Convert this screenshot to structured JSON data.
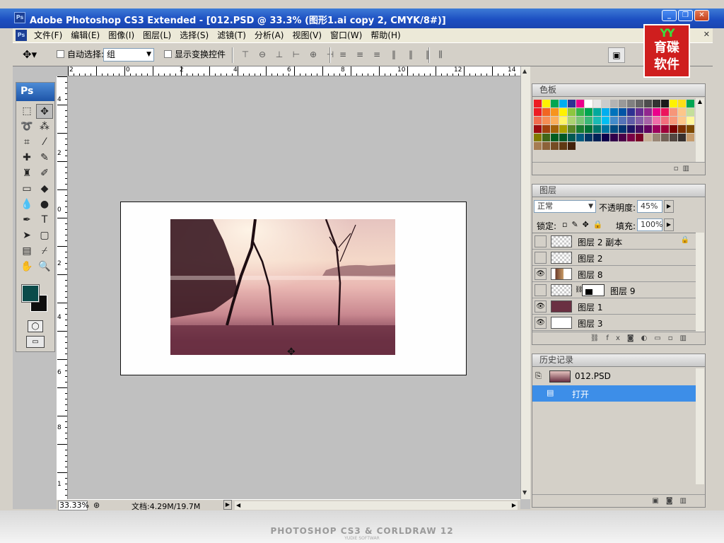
{
  "window": {
    "title": "Adobe Photoshop CS3 Extended - [012.PSD @ 33.3% (图形1.ai copy 2, CMYK/8#)]",
    "app_badge": "Ps",
    "controls": [
      "minimize",
      "restore",
      "close"
    ]
  },
  "menubar": {
    "items": [
      "文件(F)",
      "编辑(E)",
      "图像(I)",
      "图层(L)",
      "选择(S)",
      "滤镜(T)",
      "分析(A)",
      "视图(V)",
      "窗口(W)",
      "帮助(H)"
    ]
  },
  "options": {
    "auto_select_label": "自动选择:",
    "auto_select_checked": false,
    "group_value": "组",
    "show_transform_label": "显示变换控件",
    "show_transform_checked": false
  },
  "logo": {
    "mark": "YY",
    "line1": "育碟",
    "line2": "软件"
  },
  "toolbox": {
    "header": "Ps",
    "foreground_color": "#0b4b4a",
    "background_color": "#0e0e0e"
  },
  "rulers": {
    "top_labels": [
      "2",
      "0",
      "2",
      "4",
      "6",
      "8",
      "10",
      "12",
      "14"
    ],
    "left_labels": [
      "4",
      "2",
      "0",
      "2",
      "4",
      "6",
      "8",
      "1"
    ]
  },
  "status": {
    "zoom": "33.33%",
    "doc_size": "文档:4.29M/19.7M"
  },
  "panels": {
    "swatches": {
      "title": "色板",
      "colors": [
        "#ed1c24",
        "#fff200",
        "#00a651",
        "#00aeef",
        "#2e3192",
        "#ec008c",
        "#ffffff",
        "#e6e6e6",
        "#cccccc",
        "#b3b3b3",
        "#999999",
        "#808080",
        "#666666",
        "#4d4d4d",
        "#333333",
        "#1a1a1a",
        "#fff200",
        "#ffde17",
        "#00a651",
        "#ed1c24",
        "#f26522",
        "#f7941d",
        "#fff200",
        "#8dc63f",
        "#39b54a",
        "#00a651",
        "#00a99d",
        "#00aeef",
        "#0072bc",
        "#0054a6",
        "#2e3192",
        "#662d91",
        "#92278f",
        "#ec008c",
        "#ed145b",
        "#f69679",
        "#fdc689",
        "#c4df9b",
        "#f26c4f",
        "#f68e55",
        "#fbaf5c",
        "#fff467",
        "#acd372",
        "#7cc576",
        "#3bb878",
        "#1abbb4",
        "#00bff3",
        "#438ccb",
        "#5574b9",
        "#605ca8",
        "#855fa8",
        "#a763a8",
        "#f06eaa",
        "#f26d7d",
        "#f7977a",
        "#fdc68a",
        "#fff79a",
        "#9e0b0f",
        "#a0410d",
        "#a36209",
        "#aba000",
        "#598527",
        "#1a7b30",
        "#007236",
        "#00746b",
        "#0076a3",
        "#004b80",
        "#003471",
        "#1b1464",
        "#440e62",
        "#630460",
        "#9e005d",
        "#9e0039",
        "#790000",
        "#7b2e00",
        "#7d4900",
        "#827b00",
        "#406618",
        "#005e20",
        "#005826",
        "#005952",
        "#005b7f",
        "#003663",
        "#002157",
        "#0d004c",
        "#32004b",
        "#4b0049",
        "#7b0046",
        "#7a0026",
        "#c7b299",
        "#998675",
        "#736357",
        "#534741",
        "#362f2d",
        "#c69c6d",
        "#a67c52",
        "#8c6239",
        "#754c24",
        "#603913",
        "#42210b"
      ]
    },
    "layers": {
      "title": "图层",
      "blend_mode": "正常",
      "opacity_label": "不透明度:",
      "opacity": "45%",
      "lock_label": "锁定:",
      "fill_label": "填充:",
      "fill": "100%",
      "items": [
        {
          "name": "图层 2 副本",
          "visible": false,
          "locked": true
        },
        {
          "name": "图层 2",
          "visible": false,
          "locked": false
        },
        {
          "name": "图层 8",
          "visible": true,
          "locked": false
        },
        {
          "name": "图层 9",
          "visible": false,
          "locked": false
        },
        {
          "name": "图层 1",
          "visible": true,
          "locked": false
        },
        {
          "name": "图层 3",
          "visible": true,
          "locked": false
        }
      ]
    },
    "history": {
      "title": "历史记录",
      "snapshot": "012.PSD",
      "items": [
        "打开"
      ]
    }
  },
  "footer": {
    "text": "PHOTOSHOP CS3 & CORLDRAW 12",
    "sub": "YUDIE SOFTWAR"
  }
}
